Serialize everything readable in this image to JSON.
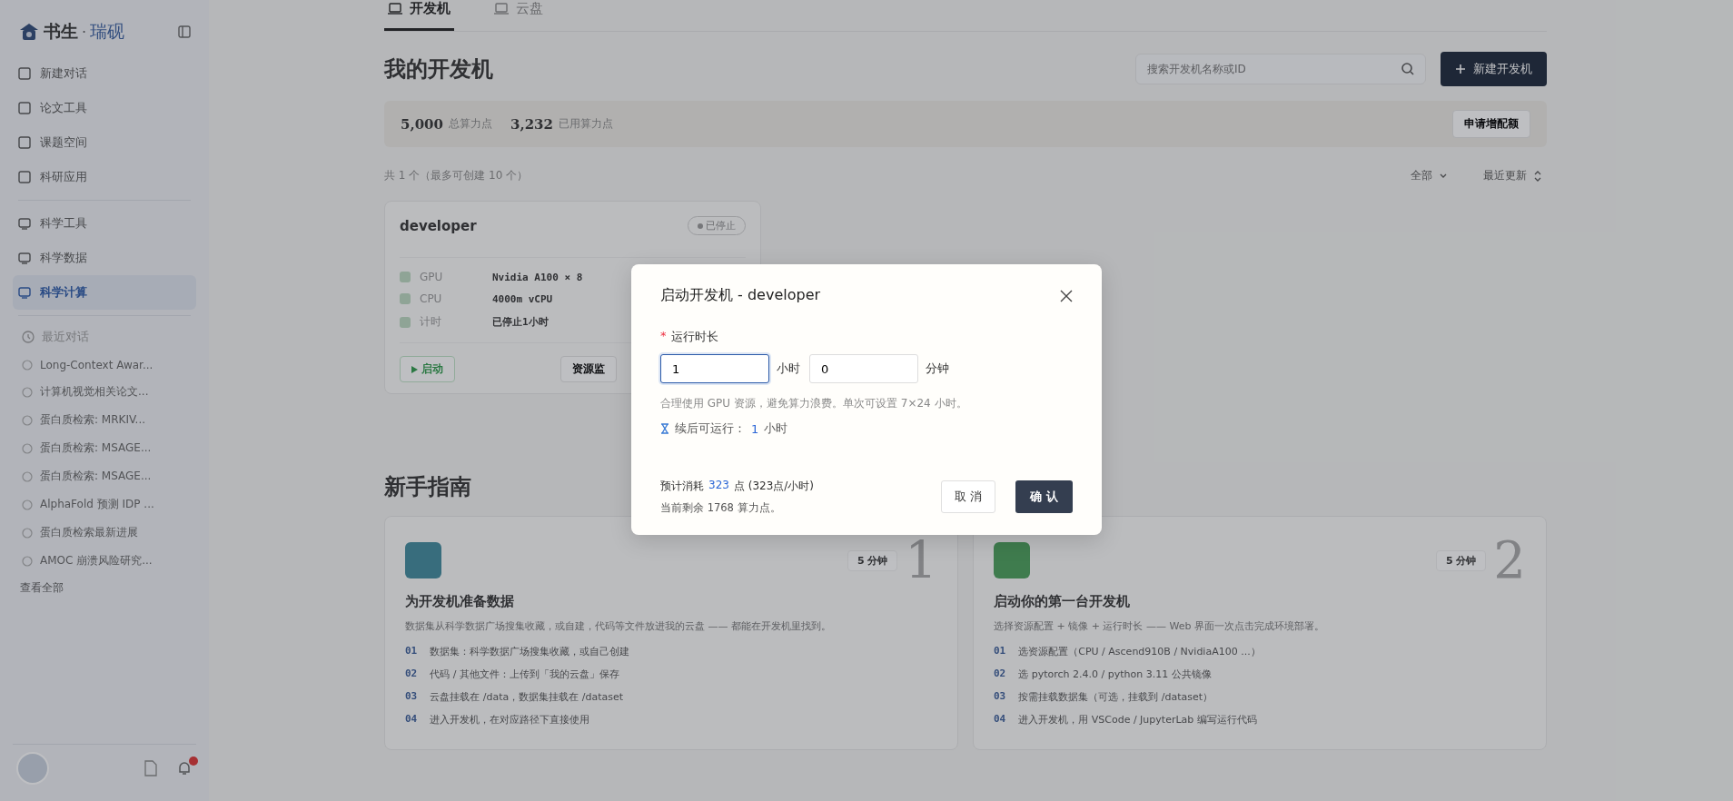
{
  "sidebar": {
    "logo": {
      "part_1": "书生",
      "separator": "·",
      "part_2": "瑞砚"
    },
    "nav": [
      {
        "label": "新建对话",
        "selected": false
      },
      {
        "label": "论文工具",
        "selected": false
      },
      {
        "label": "课题空间",
        "selected": false
      },
      {
        "label": "科研应用",
        "selected": false
      }
    ],
    "tools": [
      {
        "label": "科学工具",
        "selected": false
      },
      {
        "label": "科学数据",
        "selected": false
      },
      {
        "label": "科学计算",
        "selected": true
      }
    ],
    "recent_title": "最近对话",
    "recent": [
      "Long-Context Awar...",
      "计算机视觉相关论文...",
      "蛋白质检索: MRKIV...",
      "蛋白质检索: MSAGE...",
      "蛋白质检索: MSAGE...",
      "AlphaFold 预测 IDP ...",
      "蛋白质检索最新进展",
      "AMOC 崩溃风险研究..."
    ],
    "view_all": "查看全部",
    "has_notification": true
  },
  "tabs": [
    {
      "label": "开发机",
      "selected": true
    },
    {
      "label": "云盘",
      "selected": false
    }
  ],
  "header": {
    "title": "我的开发机",
    "search": {
      "placeholder": "搜索开发机名称或ID"
    },
    "new_button": "新建开发机"
  },
  "quota": {
    "total": "5,000",
    "total_label": "总算力点",
    "used": "3,232",
    "used_label": "已用算力点",
    "apply_button": "申请增配额"
  },
  "list_bar": {
    "count": "共 1 个（最多可创建 10 个）",
    "filter": "全部",
    "sort": "最近更新"
  },
  "machine": {
    "name": "developer",
    "status": "已停止",
    "specs": [
      {
        "label": "GPU",
        "value": "Nvidia A100 × 8"
      },
      {
        "label": "CPU",
        "value": "4000m vCPU"
      },
      {
        "label": "计时",
        "value": "已停止1小时"
      }
    ],
    "start_button": "启动",
    "monitor_button": "资源监"
  },
  "guide": {
    "title": "新手指南",
    "cards": [
      {
        "title": "为开发机准备数据",
        "duration": "5 分钟",
        "number": "1",
        "desc": "数据集从科学数据广场搜集收藏，或自建，代码等文件放进我的云盘 —— 都能在开发机里找到。",
        "steps": [
          {
            "num": "01",
            "text": "数据集：科学数据广场搜集收藏，或自己创建"
          },
          {
            "num": "02",
            "text": "代码 / 其他文件：上传到「我的云盘」保存"
          },
          {
            "num": "03",
            "text": "云盘挂载在 /data，数据集挂载在 /dataset"
          },
          {
            "num": "04",
            "text": "进入开发机，在对应路径下直接使用"
          }
        ]
      },
      {
        "title": "启动你的第一台开发机",
        "duration": "5 分钟",
        "number": "2",
        "desc": "选择资源配置 + 镜像 + 运行时长 —— Web 界面一次点击完成环境部署。",
        "steps": [
          {
            "num": "01",
            "text": "选资源配置（CPU / Ascend910B / NvidiaA100 ...）"
          },
          {
            "num": "02",
            "text": "选 pytorch 2.4.0 / python 3.11 公共镜像"
          },
          {
            "num": "03",
            "text": "按需挂载数据集（可选，挂载到 /dataset）"
          },
          {
            "num": "04",
            "text": "进入开发机，用 VSCode / JupyterLab 编写运行代码"
          }
        ]
      }
    ]
  },
  "dialog": {
    "title": "启动开发机 - developer",
    "field_label": "运行时长",
    "required_mark": "*",
    "hours": {
      "value": "1",
      "focused": true
    },
    "hours_unit": "小时",
    "minutes": {
      "value": "0",
      "focused": false
    },
    "minutes_unit": "分钟",
    "hint": "合理使用 GPU 资源，避免算力浪费。单次可设置 7×24 小时。",
    "after_label": "续后可运行：",
    "after_value": "1",
    "after_unit": "小时",
    "cost_prefix": "预计消耗",
    "cost_points": "323",
    "cost_suffix": "点 (323点/小时)",
    "balance": "当前剩余 1768 算力点。",
    "cancel_button": "取 消",
    "confirm_button": "确 认"
  }
}
